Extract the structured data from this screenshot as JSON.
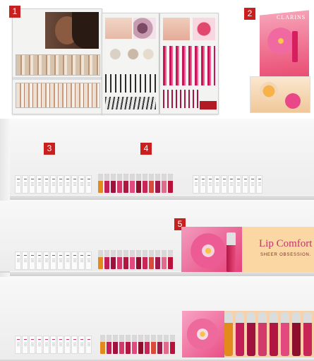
{
  "markers": [
    "1",
    "2",
    "3",
    "4",
    "5"
  ],
  "brand": "CLARINS",
  "banner": {
    "title": "Lip Comfort O",
    "subtitle": "SHEER OBSESSION."
  },
  "colors": {
    "marker_red": "#c8201e",
    "brand_red": "#b31b24",
    "pink": "#e94787",
    "peach": "#f3d6b3"
  }
}
